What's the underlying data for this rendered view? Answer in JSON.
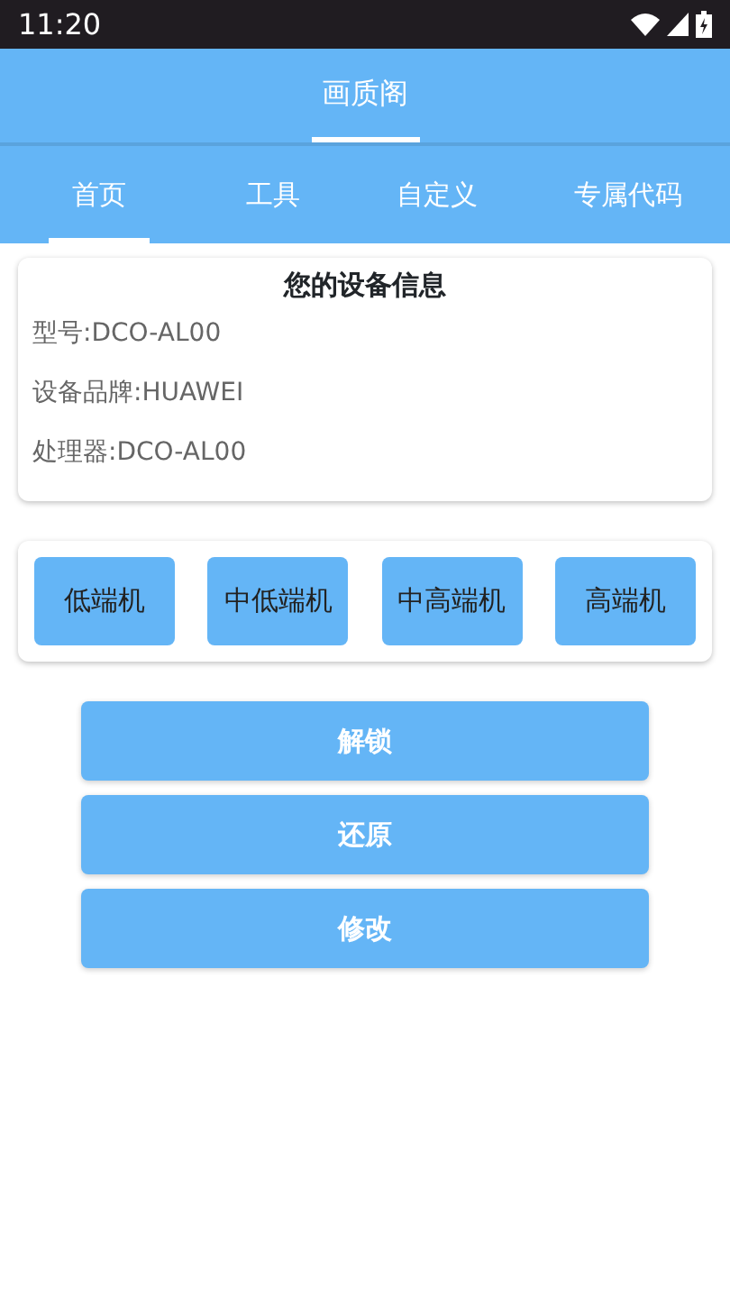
{
  "status_bar": {
    "time": "11:20"
  },
  "header": {
    "tabs": [
      {
        "label": "画质阁",
        "selected": true
      }
    ]
  },
  "tabs": [
    {
      "label": "首页",
      "selected": true
    },
    {
      "label": "工具",
      "selected": false
    },
    {
      "label": "自定义",
      "selected": false
    },
    {
      "label": "专属代码",
      "selected": false
    }
  ],
  "device_info": {
    "title": "您的设备信息",
    "lines": [
      "型号:DCO-AL00",
      "设备品牌:HUAWEI",
      "处理器:DCO-AL00"
    ]
  },
  "tier_buttons": [
    "低端机",
    "中低端机",
    "中高端机",
    "高端机"
  ],
  "actions": [
    "解锁",
    "还原",
    "修改"
  ]
}
